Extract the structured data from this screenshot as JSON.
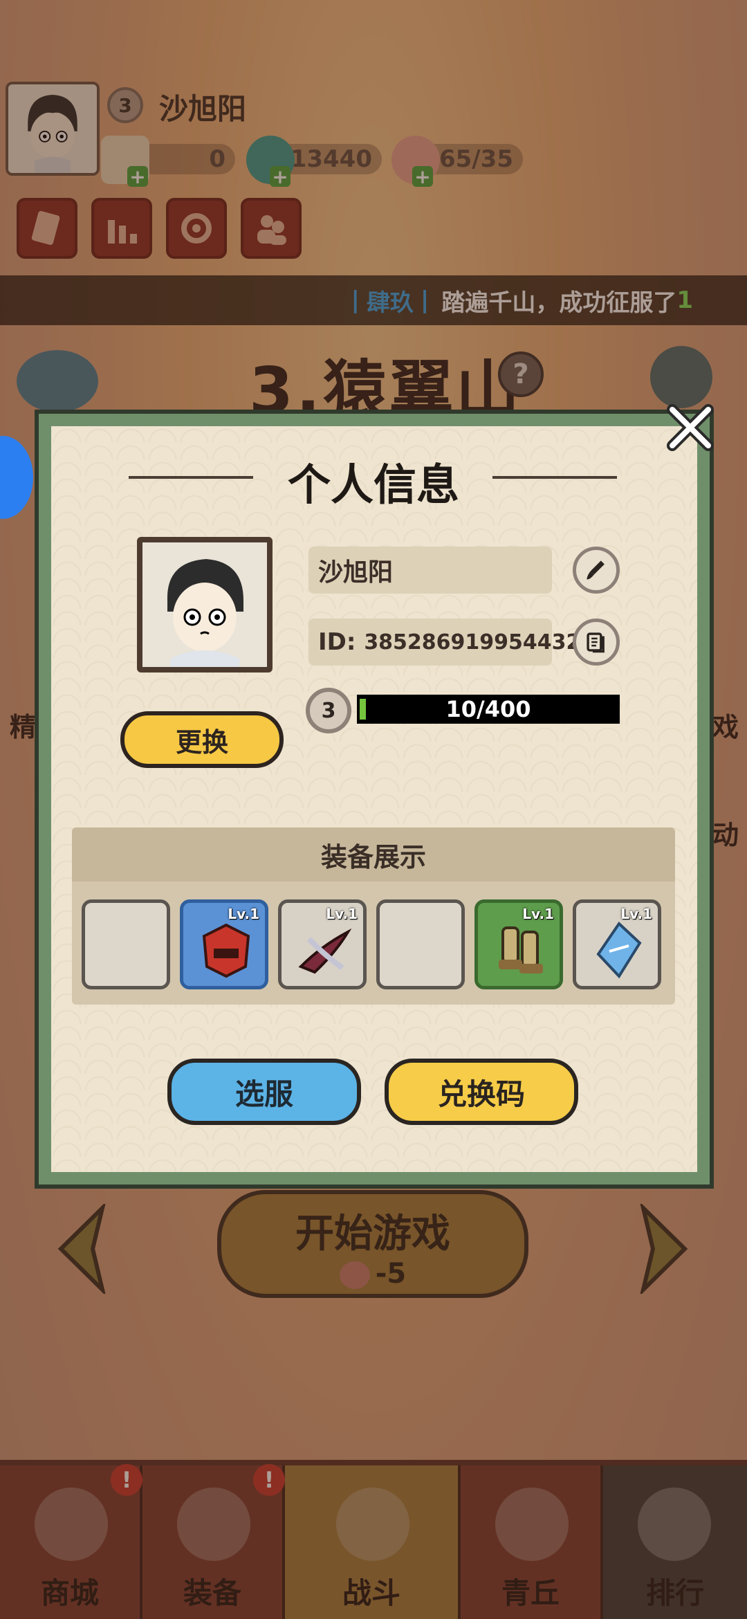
{
  "header": {
    "player_level": "3",
    "player_name": "沙旭阳",
    "resources": [
      {
        "icon": "scroll-icon",
        "value": "0"
      },
      {
        "icon": "jade-dragon-icon",
        "value": "13440"
      },
      {
        "icon": "peach-icon",
        "value": "65/35"
      }
    ],
    "buttons": [
      "card-icon",
      "ranking-icon",
      "settings-icon",
      "friends-icon"
    ]
  },
  "ticker": {
    "server": "肆玖",
    "message": "踏遍千山，成功征服了",
    "count": "1"
  },
  "stage": {
    "title": "3.猿翼山",
    "help": "?"
  },
  "profile_modal": {
    "title": "个人信息",
    "name": "沙旭阳",
    "id_label": "ID: ",
    "id_value": "385286919954432",
    "level": "3",
    "xp_current": 10,
    "xp_max": 400,
    "xp_text": "10/400",
    "change_button": "更换",
    "equipment_header": "装备展示",
    "equipment": [
      {
        "empty": true,
        "level": ""
      },
      {
        "empty": false,
        "level": "Lv.1",
        "bg": "#5b92d6",
        "item": "mask-icon"
      },
      {
        "empty": false,
        "level": "Lv.1",
        "bg": "#d8d2c6",
        "item": "horn-weapon-icon"
      },
      {
        "empty": true,
        "level": ""
      },
      {
        "empty": false,
        "level": "Lv.1",
        "bg": "#5e9d4c",
        "item": "boots-icon"
      },
      {
        "empty": false,
        "level": "Lv.1",
        "bg": "#d8d2c6",
        "item": "talisman-icon"
      }
    ],
    "server_button": "选服",
    "redeem_button": "兑换码"
  },
  "start": {
    "label": "开始游戏",
    "cost": "-5"
  },
  "side_labels": {
    "left": "精",
    "right_top": "戏",
    "right_bottom": "动"
  },
  "bottom_nav": [
    {
      "label": "商城",
      "badge": "!"
    },
    {
      "label": "装备",
      "badge": "!"
    },
    {
      "label": "战斗",
      "badge": ""
    },
    {
      "label": "青丘",
      "badge": ""
    },
    {
      "label": "排行",
      "badge": ""
    }
  ]
}
